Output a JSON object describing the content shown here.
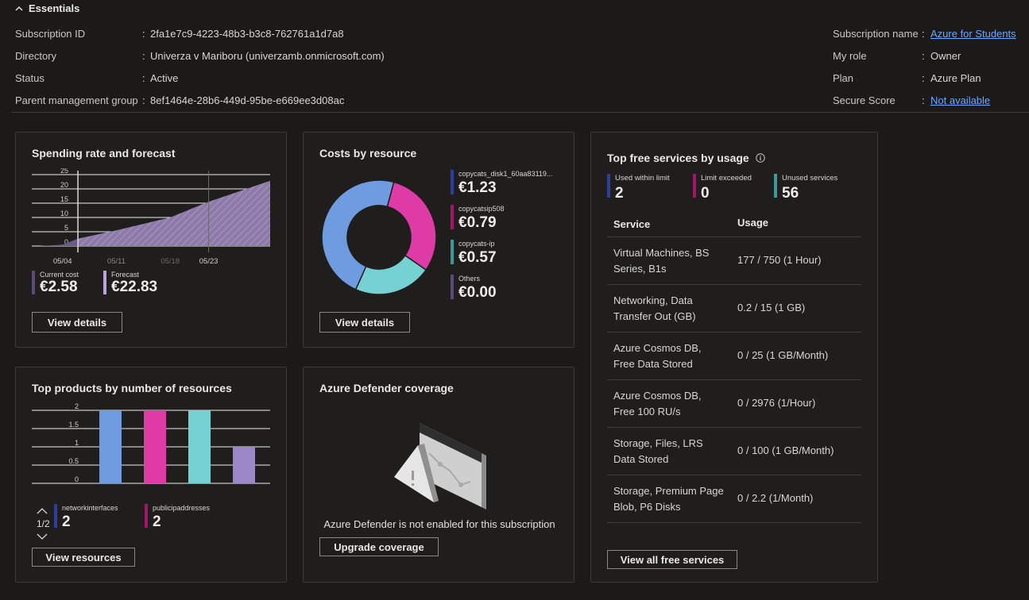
{
  "essentials": {
    "title": "Essentials",
    "left": [
      {
        "label": "Subscription ID",
        "value": "2fa1e7c9-4223-48b3-b3c8-762761a1d7a8"
      },
      {
        "label": "Directory",
        "value": "Univerza v Mariboru (univerzamb.onmicrosoft.com)"
      },
      {
        "label": "Status",
        "value": "Active"
      },
      {
        "label": "Parent management group",
        "value": "8ef1464e-28b6-449d-95be-e669ee3d08ac"
      }
    ],
    "right": [
      {
        "label": "Subscription name",
        "value": "Azure for Students",
        "link": true
      },
      {
        "label": "My role",
        "value": "Owner",
        "link": false
      },
      {
        "label": "Plan",
        "value": "Azure Plan",
        "link": false
      },
      {
        "label": "Secure Score",
        "value": "Not available",
        "link": true
      }
    ]
  },
  "spending": {
    "title": "Spending rate and forecast",
    "legend": [
      {
        "name": "Current cost",
        "value": "€2.58",
        "color": "#5c4a7a"
      },
      {
        "name": "Forecast",
        "value": "€22.83",
        "color": "#b9a3d9"
      }
    ],
    "button": "View details"
  },
  "costs": {
    "title": "Costs by resource",
    "legend": [
      {
        "name": "copycats_disk1_60aa83119...",
        "value": "€1.23",
        "color": "#2b3f9e"
      },
      {
        "name": "copycatsip508",
        "value": "€0.79",
        "color": "#a3146a"
      },
      {
        "name": "copycats-ip",
        "value": "€0.57",
        "color": "#3a9a9a"
      },
      {
        "name": "Others",
        "value": "€0.00",
        "color": "#5c4a7a"
      }
    ],
    "button": "View details"
  },
  "products": {
    "title": "Top products by number of resources",
    "pager": "1/2",
    "legend": [
      {
        "name": "networkinterfaces",
        "value": "2",
        "color": "#2b3f9e"
      },
      {
        "name": "publicipaddresses",
        "value": "2",
        "color": "#a3146a"
      }
    ],
    "button": "View resources"
  },
  "defender": {
    "title": "Azure Defender coverage",
    "message": "Azure Defender is not enabled for this subscription",
    "button": "Upgrade coverage"
  },
  "free": {
    "title": "Top free services by usage",
    "stats": [
      {
        "name": "Used within limit",
        "value": "2",
        "color": "#2b3f9e"
      },
      {
        "name": "Limit exceeded",
        "value": "0",
        "color": "#a3146a"
      },
      {
        "name": "Unused services",
        "value": "56",
        "color": "#3a9a9a"
      }
    ],
    "columns": [
      "Service",
      "Usage"
    ],
    "rows": [
      {
        "service": "Virtual Machines, BS Series, B1s",
        "usage": "177 / 750 (1 Hour)"
      },
      {
        "service": "Networking, Data Transfer Out (GB)",
        "usage": "0.2 / 15 (1 GB)"
      },
      {
        "service": "Azure Cosmos DB, Free Data Stored",
        "usage": "0 / 25 (1 GB/Month)"
      },
      {
        "service": "Azure Cosmos DB, Free 100 RU/s",
        "usage": "0 / 2976 (1/Hour)"
      },
      {
        "service": "Storage, Files, LRS Data Stored",
        "usage": "0 / 100 (1 GB/Month)"
      },
      {
        "service": "Storage, Premium Page Blob, P6 Disks",
        "usage": "0 / 2.2 (1/Month)"
      }
    ],
    "button": "View all free services"
  },
  "chart_data": [
    {
      "type": "area",
      "title": "Spending rate and forecast",
      "ylim": [
        0,
        25
      ],
      "yticks": [
        "25",
        "20",
        "15",
        "10",
        "5",
        "0"
      ],
      "xticks": [
        "05/04",
        "05/11",
        "05/18",
        "05/23"
      ],
      "series": [
        {
          "name": "Current cost",
          "x": [
            "05/01",
            "05/04",
            "05/06"
          ],
          "values": [
            0,
            0.5,
            2.58
          ]
        },
        {
          "name": "Forecast",
          "x": [
            "05/06",
            "05/11",
            "05/18",
            "05/23",
            "05/31"
          ],
          "values": [
            2.58,
            5.5,
            10,
            15.5,
            22.83
          ]
        }
      ]
    },
    {
      "type": "pie",
      "title": "Costs by resource",
      "categories": [
        "copycats_disk1_60aa83119...",
        "copycatsip508",
        "copycats-ip",
        "Others"
      ],
      "values": [
        1.23,
        0.79,
        0.57,
        0.0
      ],
      "colors": [
        "#6f9be0",
        "#de3ba6",
        "#76d1d3",
        "#8e76c4"
      ]
    },
    {
      "type": "bar",
      "title": "Top products by number of resources",
      "yticks": [
        "2",
        "1.5",
        "1",
        "0.5",
        "0"
      ],
      "ylim": [
        0,
        2
      ],
      "categories": [
        "networkinterfaces",
        "publicipaddresses",
        "",
        ""
      ],
      "values": [
        2,
        2,
        2,
        1
      ],
      "colors": [
        "#6f9be0",
        "#de3ba6",
        "#76d1d3",
        "#9b86c8"
      ]
    }
  ]
}
